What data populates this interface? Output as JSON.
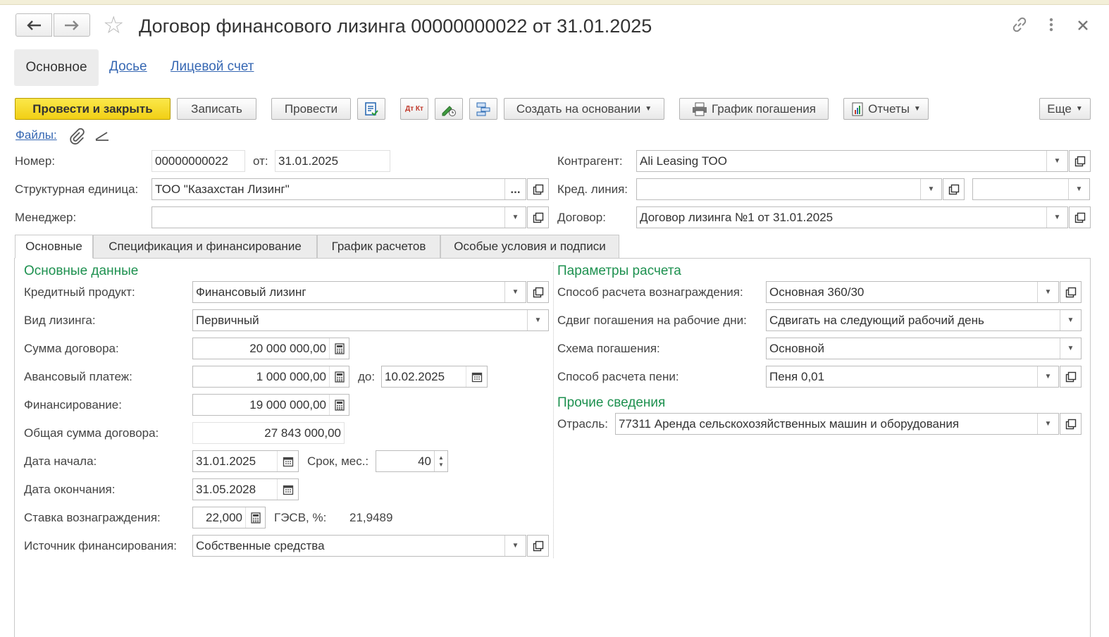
{
  "window": {
    "title": "Договор финансового лизинга 00000000022 от 31.01.2025",
    "back_label": "🡐",
    "forward_label": "🡒"
  },
  "form_tabs": [
    "Основное",
    "Досье",
    "Лицевой счет"
  ],
  "toolbar": {
    "post_close": "Провести и закрыть",
    "save": "Записать",
    "post": "Провести",
    "create_based": "Создать на основании",
    "schedule": "График погашения",
    "reports": "Отчеты",
    "more": "Еще",
    "dt_kt": "Дт Кт"
  },
  "files_link": "Файлы:",
  "header": {
    "number_label": "Номер:",
    "number": "00000000022",
    "from_label": "от:",
    "date": "31.01.2025",
    "unit_label": "Структурная единица:",
    "unit": "ТОО \"Казахстан Лизинг\"",
    "manager_label": "Менеджер:",
    "manager": "",
    "counterparty_label": "Контрагент:",
    "counterparty": "Ali Leasing ТОО",
    "credit_line_label": "Кред. линия:",
    "credit_line": "",
    "credit_line_extra": "",
    "contract_label": "Договор:",
    "contract": "Договор лизинга №1 от 31.01.2025"
  },
  "page_tabs": [
    "Основные",
    "Спецификация и финансирование",
    "График расчетов",
    "Особые условия и подписи"
  ],
  "main": {
    "section_title": "Основные данные",
    "credit_product_label": "Кредитный продукт:",
    "credit_product": "Финансовый лизинг",
    "lease_type_label": "Вид лизинга:",
    "lease_type": "Первичный",
    "contract_sum_label": "Сумма договора:",
    "contract_sum": "20 000 000,00",
    "advance_label": "Авансовый платеж:",
    "advance": "1 000 000,00",
    "until_label": "до:",
    "advance_until": "10.02.2025",
    "financing_label": "Финансирование:",
    "financing": "19 000 000,00",
    "total_label": "Общая сумма договора:",
    "total": "27 843 000,00",
    "start_label": "Дата начала:",
    "start": "31.01.2025",
    "term_label": "Срок, мес.:",
    "term": "40",
    "end_label": "Дата окончания:",
    "end": "31.05.2028",
    "rate_label": "Ставка вознаграждения:",
    "rate": "22,000",
    "gesv_label": "ГЭСВ, %:",
    "gesv": "21,9489",
    "source_label": "Источник финансирования:",
    "source": "Собственные средства"
  },
  "calc": {
    "section_title": "Параметры расчета",
    "method_label": "Способ расчета вознаграждения:",
    "method": "Основная 360/30",
    "shift_label": "Сдвиг погашения на рабочие дни:",
    "shift": "Сдвигать на следующий рабочий день",
    "scheme_label": "Схема погашения:",
    "scheme": "Основной",
    "penalty_label": "Способ расчета пени:",
    "penalty": "Пеня 0,01"
  },
  "other": {
    "section_title": "Прочие сведения",
    "industry_label": "Отрасль:",
    "industry": "77311 Аренда сельскохозяйственных машин и оборудования"
  },
  "icons": [
    "arrow-left-icon",
    "arrow-right-icon",
    "star-icon",
    "link-icon",
    "more-vert-icon",
    "close-icon",
    "paperclip-icon",
    "pen-icon",
    "calendar-icon",
    "calculator-icon",
    "open-icon",
    "printer-icon",
    "report-icon"
  ]
}
